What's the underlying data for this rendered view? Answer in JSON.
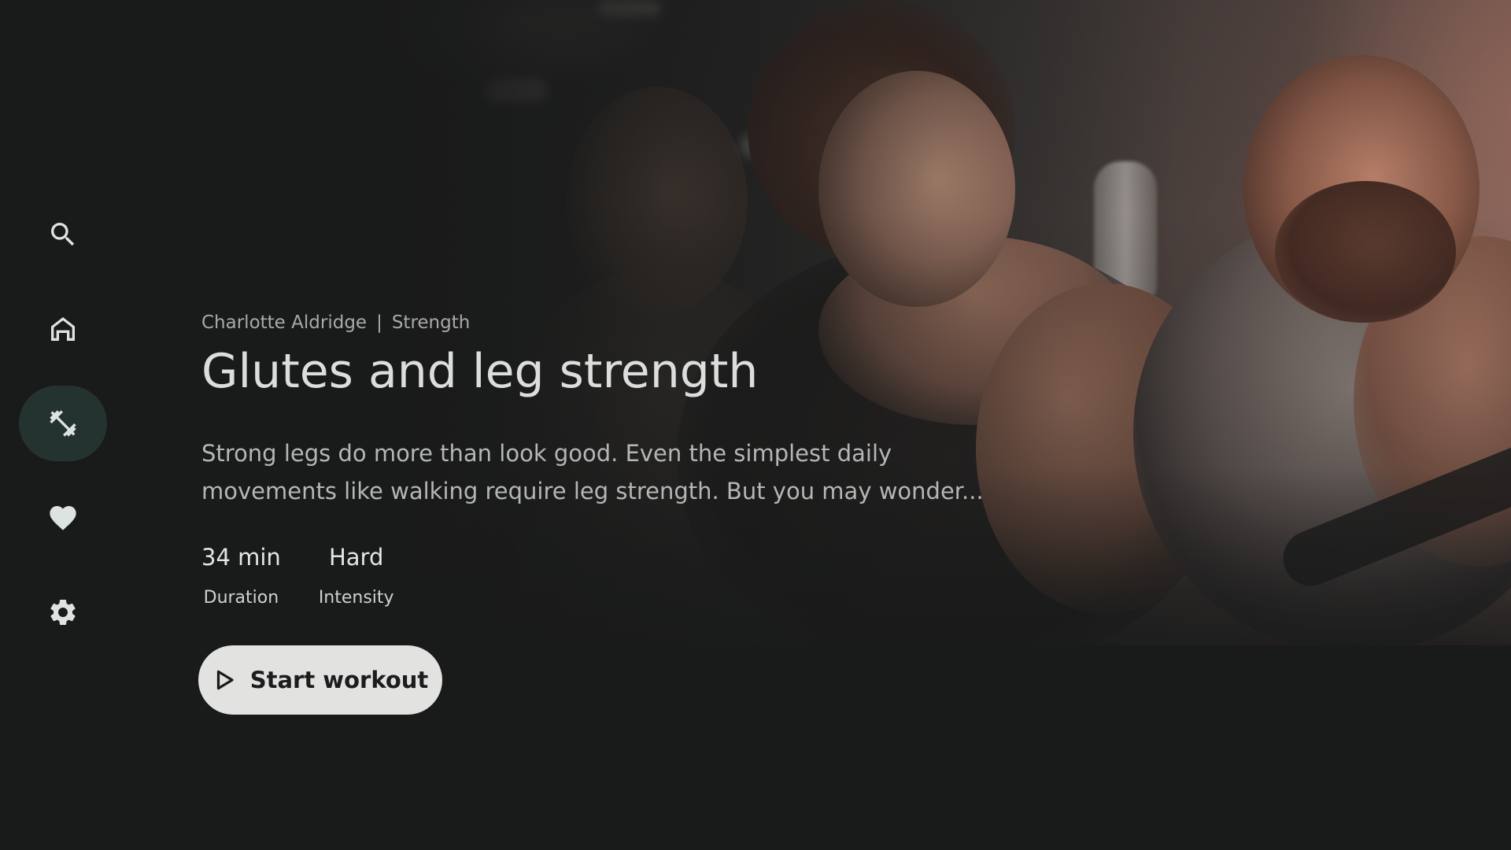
{
  "nav": {
    "items": [
      {
        "name": "search",
        "icon": "search-icon",
        "active": false
      },
      {
        "name": "home",
        "icon": "home-icon",
        "active": false
      },
      {
        "name": "workouts",
        "icon": "dumbbell-icon",
        "active": true
      },
      {
        "name": "favorites",
        "icon": "heart-icon",
        "active": false
      },
      {
        "name": "settings",
        "icon": "gear-icon",
        "active": false
      }
    ]
  },
  "workout": {
    "instructor": "Charlotte Aldridge",
    "separator": "|",
    "category": "Strength",
    "title": "Glutes and leg strength",
    "description": "Strong legs do more than look good. Even the simplest daily movements like walking require leg strength. But you may wonder...",
    "stats": {
      "duration_value": "34 min",
      "duration_label": "Duration",
      "intensity_value": "Hard",
      "intensity_label": "Intensity"
    },
    "start_label": "Start workout"
  },
  "colors": {
    "background": "#191a1a",
    "nav_active": "#253330",
    "button": "#e2e3e1",
    "icon": "#dde3e0"
  }
}
